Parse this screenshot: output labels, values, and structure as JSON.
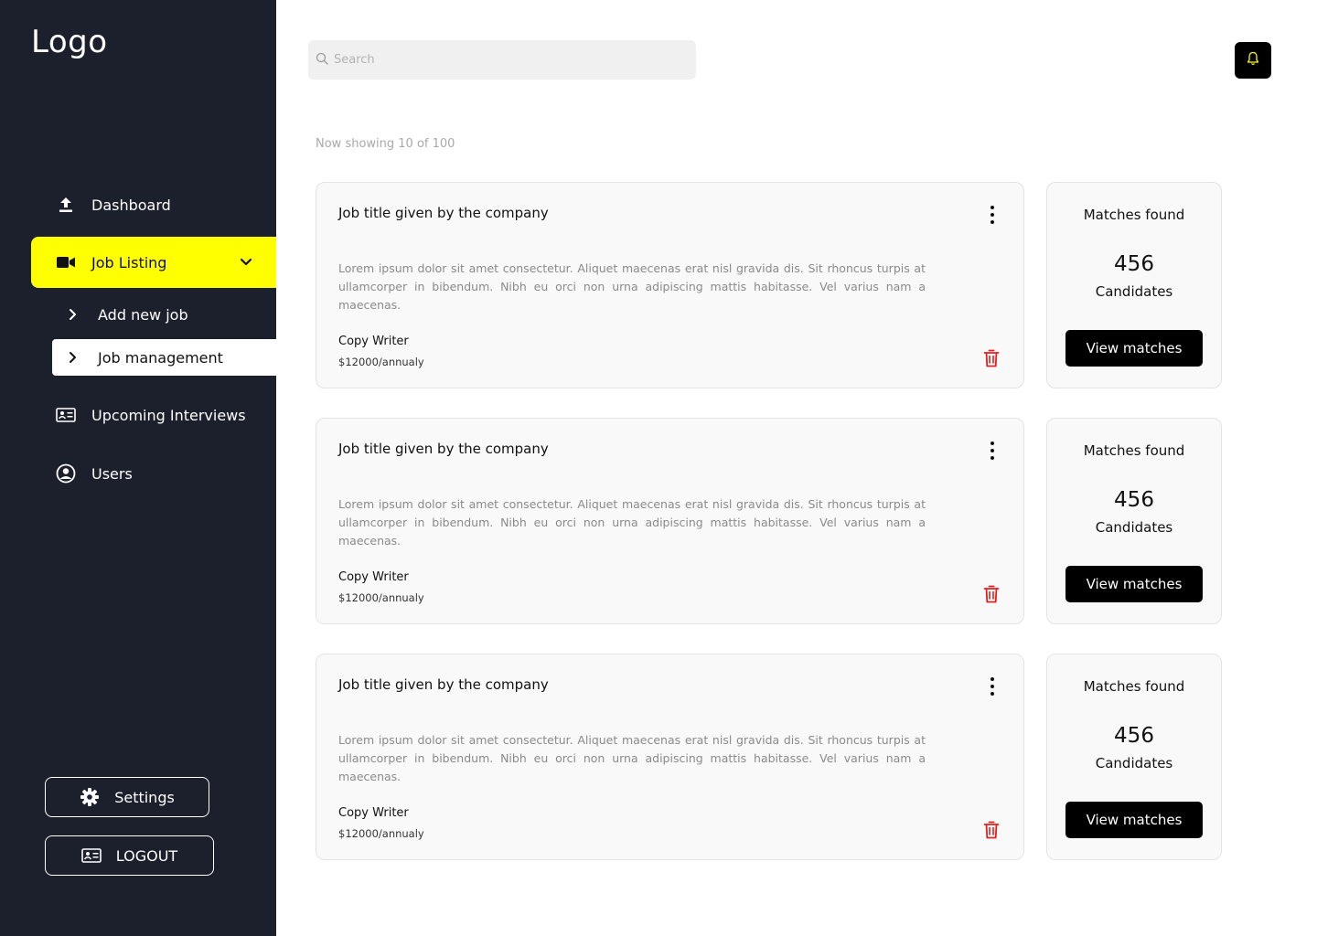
{
  "colors": {
    "sidebar_bg": "#1c202d",
    "accent": "#ffff00",
    "danger": "#e02020"
  },
  "sidebar": {
    "logo": "Logo",
    "nav": [
      {
        "label": "Dashboard",
        "icon": "upload-icon"
      },
      {
        "label": "Job Listing",
        "icon": "video-camera-icon",
        "active": true
      },
      {
        "label": "Upcoming Interviews",
        "icon": "id-card-icon"
      },
      {
        "label": "Users",
        "icon": "user-circle-icon"
      }
    ],
    "sub_nav": [
      {
        "label": "Add new job",
        "icon": "chevron-right-icon"
      },
      {
        "label": "Job management",
        "icon": "chevron-right-icon",
        "selected": true
      }
    ],
    "settings_label": "Settings",
    "logout_label": "LOGOUT"
  },
  "header": {
    "search_placeholder": "Search",
    "search_value": "",
    "notification_icon": "bell-icon"
  },
  "listing": {
    "showing_text": "Now showing 10 of 100",
    "jobs": [
      {
        "title": "Job title given by the company",
        "description": "Lorem ipsum dolor sit amet consectetur. Aliquet maecenas erat nisl gravida dis. Sit rhoncus turpis at ullamcorper in bibendum. Nibh eu orci non urna adipiscing mattis habitasse. Vel varius nam a maecenas.",
        "role": "Copy Writer",
        "salary": "$12000/annualy",
        "matches_label": "Matches found",
        "matches_count": "456",
        "matches_unit": "Candidates",
        "view_label": "View matches"
      },
      {
        "title": "Job title given by the company",
        "description": "Lorem ipsum dolor sit amet consectetur. Aliquet maecenas erat nisl gravida dis. Sit rhoncus turpis at ullamcorper in bibendum. Nibh eu orci non urna adipiscing mattis habitasse. Vel varius nam a maecenas.",
        "role": "Copy Writer",
        "salary": "$12000/annualy",
        "matches_label": "Matches found",
        "matches_count": "456",
        "matches_unit": "Candidates",
        "view_label": "View matches"
      },
      {
        "title": "Job title given by the company",
        "description": "Lorem ipsum dolor sit amet consectetur. Aliquet maecenas erat nisl gravida dis. Sit rhoncus turpis at ullamcorper in bibendum. Nibh eu orci non urna adipiscing mattis habitasse. Vel varius nam a maecenas.",
        "role": "Copy Writer",
        "salary": "$12000/annualy",
        "matches_label": "Matches found",
        "matches_count": "456",
        "matches_unit": "Candidates",
        "view_label": "View matches"
      }
    ]
  }
}
